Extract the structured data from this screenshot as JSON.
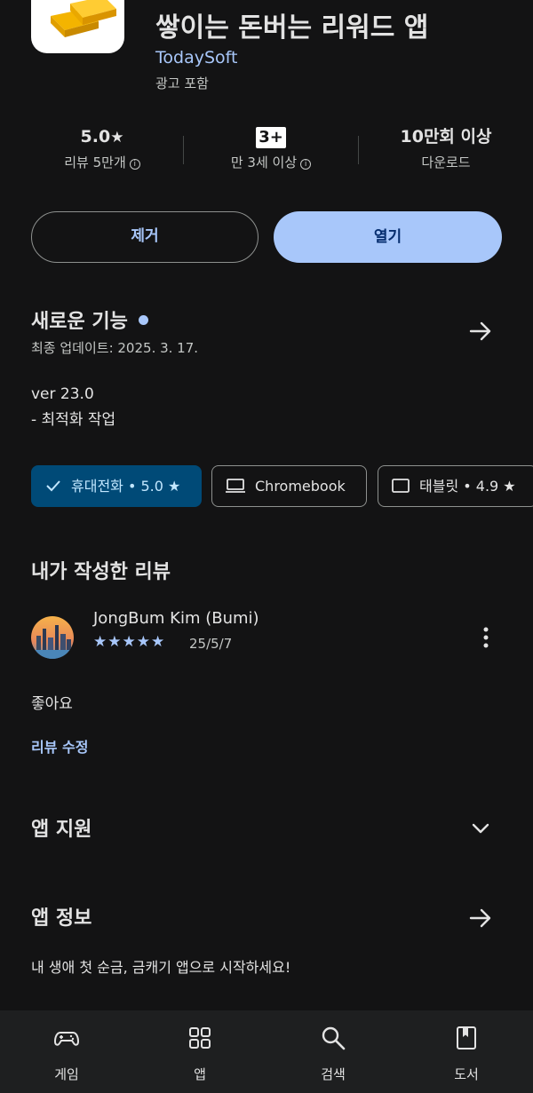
{
  "app": {
    "title": "쌓이는 돈버는 리워드 앱",
    "developer": "TodaySoft",
    "ads_label": "광고 포함"
  },
  "stats": {
    "rating": "5.0",
    "rating_star": "★",
    "reviews_label": "리뷰 5만개",
    "content_rating": "3+",
    "content_rating_label": "만 3세 이상",
    "downloads": "10만회 이상",
    "downloads_label": "다운로드",
    "info_icon": "ⓘ"
  },
  "actions": {
    "remove_label": "제거",
    "open_label": "열기"
  },
  "whats_new": {
    "title": "새로운 기능",
    "last_updated": "최종 업데이트: 2025. 3. 17.",
    "notes": "ver 23.0\n- 최적화 작업"
  },
  "device_chips": [
    {
      "label": "휴대전화 • 5.0 ★",
      "icon": "check-icon",
      "selected": true
    },
    {
      "label": "Chromebook",
      "icon": "laptop-icon",
      "selected": false
    },
    {
      "label": "태블릿 • 4.9 ★",
      "icon": "tablet-icon",
      "selected": false
    }
  ],
  "my_review": {
    "title": "내가 작성한 리뷰",
    "reviewer": "JongBum Kim (Bumi)",
    "stars": "★★★★★",
    "date": "25/5/7",
    "text": "좋아요",
    "edit_label": "리뷰 수정"
  },
  "app_support": {
    "title": "앱 지원"
  },
  "about": {
    "title": "앱 정보",
    "text": "내 생애 첫 순금, 금캐기 앱으로 시작하세요!"
  },
  "bottom_nav": [
    {
      "label": "게임",
      "icon": "gamepad-icon"
    },
    {
      "label": "앱",
      "icon": "apps-grid-icon"
    },
    {
      "label": "검색",
      "icon": "search-icon"
    },
    {
      "label": "도서",
      "icon": "book-icon"
    }
  ],
  "colors": {
    "background": "#131314",
    "accent": "#a8c7fa",
    "selected_chip": "#004a77",
    "nav_bar": "#1e1f20"
  }
}
